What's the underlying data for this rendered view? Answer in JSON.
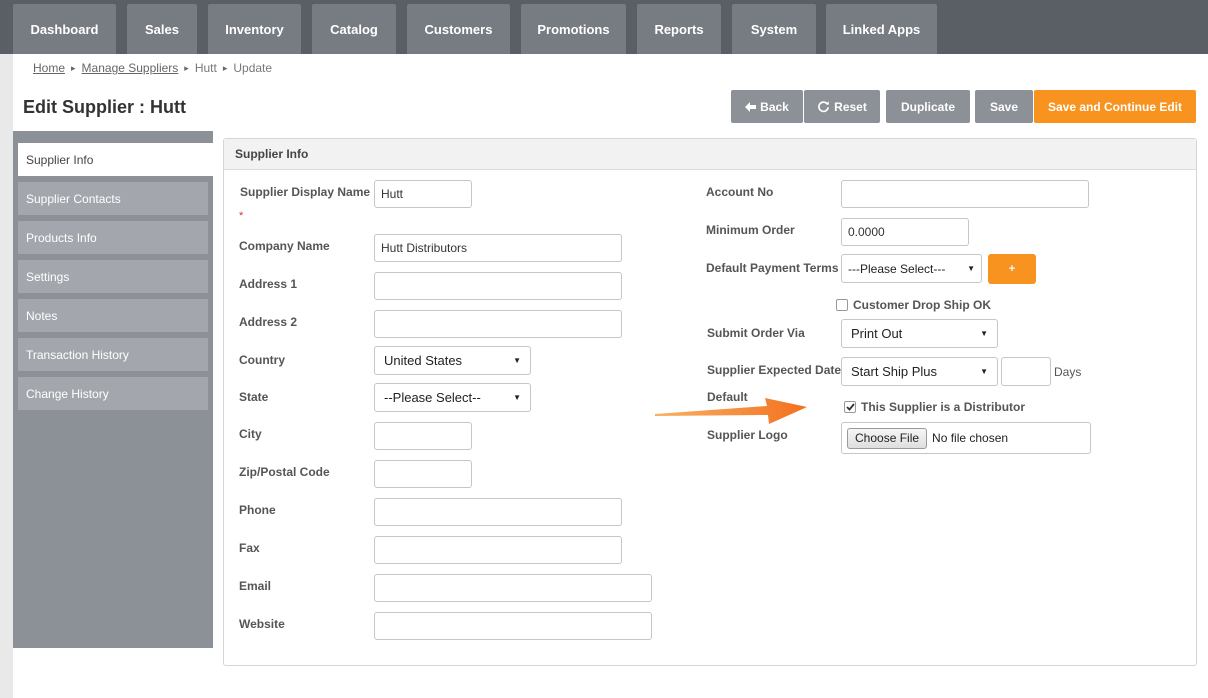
{
  "nav": {
    "tabs": [
      "Dashboard",
      "Sales",
      "Inventory",
      "Catalog",
      "Customers",
      "Promotions",
      "Reports",
      "System",
      "Linked Apps"
    ]
  },
  "breadcrumb": {
    "home": "Home",
    "manage": "Manage Suppliers",
    "supplier": "Hutt",
    "current": "Update"
  },
  "page": {
    "title": "Edit Supplier : Hutt"
  },
  "toolbar": {
    "back": "Back",
    "reset": "Reset",
    "duplicate": "Duplicate",
    "save": "Save",
    "save_continue": "Save and Continue Edit"
  },
  "sidebar": {
    "items": [
      "Supplier Info",
      "Supplier Contacts",
      "Products Info",
      "Settings",
      "Notes",
      "Transaction History",
      "Change History"
    ]
  },
  "panel": {
    "title": "Supplier Info"
  },
  "form_left": {
    "display_name_label": "Supplier Display Name",
    "display_name_value": "Hutt",
    "required_mark": "*",
    "company_label": "Company Name",
    "company_value": "Hutt Distributors",
    "address1_label": "Address 1",
    "address2_label": "Address 2",
    "country_label": "Country",
    "country_value": "United States",
    "state_label": "State",
    "state_value": "--Please Select--",
    "city_label": "City",
    "zip_label": "Zip/Postal Code",
    "phone_label": "Phone",
    "fax_label": "Fax",
    "email_label": "Email",
    "website_label": "Website"
  },
  "form_right": {
    "account_label": "Account No",
    "min_order_label": "Minimum Order",
    "min_order_value": "0.0000",
    "payment_terms_label": "Default Payment Terms",
    "payment_terms_value": "---Please Select---",
    "plus_label": "+",
    "drop_ship_label": "Customer Drop Ship OK",
    "drop_ship_checked": false,
    "submit_via_label": "Submit Order Via",
    "submit_via_value": "Print Out",
    "expected_date_label": "Supplier Expected Date",
    "expected_date_label2": "Default",
    "expected_date_value": "Start Ship Plus",
    "days_label": "Days",
    "distributor_label": "This Supplier is a Distributor",
    "distributor_checked": true,
    "logo_label": "Supplier Logo",
    "choose_file": "Choose File",
    "no_file": "No file chosen"
  },
  "colors": {
    "nav_bg": "#5a5f66",
    "nav_tab": "#777c83",
    "accent": "#f7931e",
    "button_gray": "#8c9198",
    "annotation_arrow": "#f47d20"
  },
  "icons": {
    "back": "arrow-left-icon",
    "reset": "refresh-icon",
    "select": "caret-down-icon",
    "annotation": "orange-arrow-pointer"
  }
}
